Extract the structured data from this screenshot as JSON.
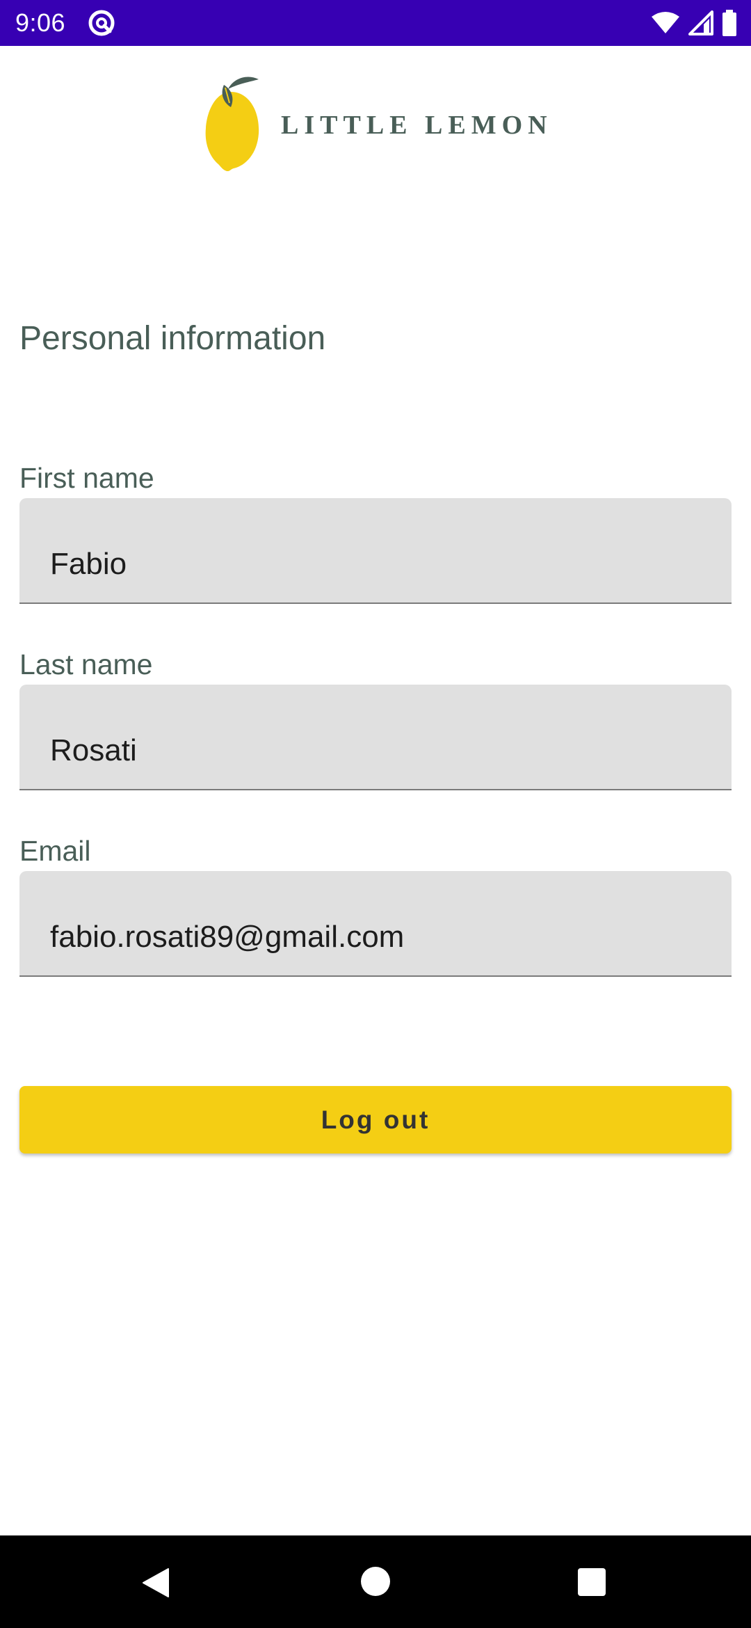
{
  "status_bar": {
    "time": "9:06",
    "icons": [
      "app-notification-icon",
      "wifi-icon",
      "cellular-signal-icon",
      "battery-icon"
    ],
    "background_color": "#3700B3"
  },
  "header": {
    "brand_name": "LITTLE LEMON",
    "brand_color": "#495E57",
    "logo_icon": "lemon-icon",
    "logo_color": "#F4CE14"
  },
  "main": {
    "section_title": "Personal information",
    "fields": [
      {
        "label": "First name",
        "value": "Fabio"
      },
      {
        "label": "Last name",
        "value": "Rosati"
      },
      {
        "label": "Email",
        "value": "fabio.rosati89@gmail.com"
      }
    ],
    "logout_label": "Log out",
    "accent_color": "#F4CE14"
  },
  "navigation_bar": {
    "icons": [
      "back-icon",
      "home-icon",
      "recents-icon"
    ]
  }
}
